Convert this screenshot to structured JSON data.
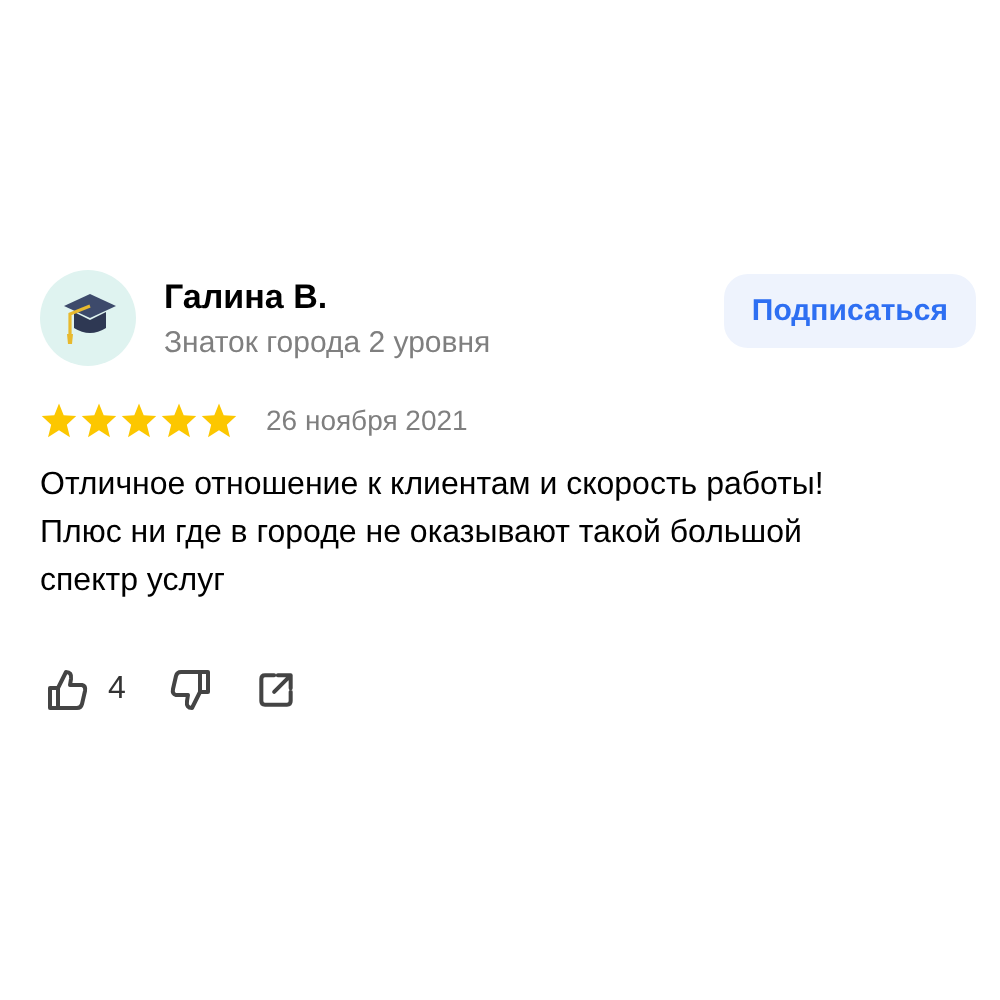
{
  "review": {
    "author": "Галина В.",
    "author_level": "Знаток города 2 уровня",
    "subscribe_button": "Подписаться",
    "stars": 5,
    "date": "26 ноября 2021",
    "paragraphs": [
      "Отличное отношение к клиентам и скорость работы!",
      "Плюс ни где в городе не оказывают такой большой спектр услуг"
    ],
    "likes": "4"
  }
}
